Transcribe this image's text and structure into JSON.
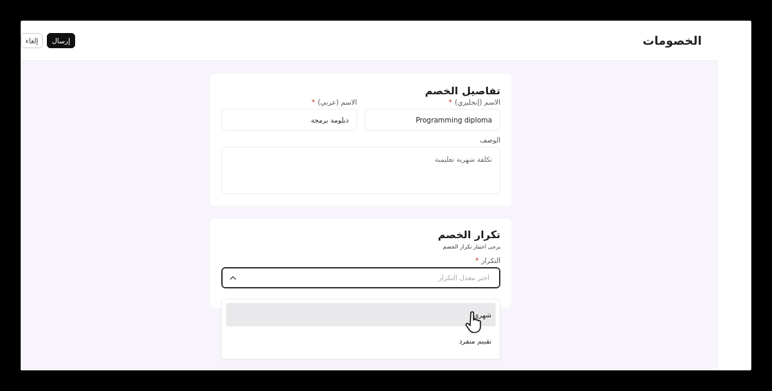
{
  "header": {
    "title": "الخصومات",
    "buttons": [
      {
        "label": "إرسال",
        "kind": "primary"
      },
      {
        "label": "إلغاء",
        "kind": "secondary"
      }
    ]
  },
  "details_card": {
    "title": "تفاصيل الخصم",
    "fields": [
      {
        "label": "الاسم (إنجليزي)",
        "required_mark": "*",
        "value": "Programming diploma"
      },
      {
        "label": "الاسم (عربي)",
        "required_mark": "*",
        "value": "دبلومة برمجة"
      }
    ],
    "description": {
      "label": "الوصف",
      "value": "تكلفة شهرية تعليمية"
    }
  },
  "recurrence_card": {
    "title": "تكرار الخصم",
    "subtitle": "يرجى اختيار تكرار الخصم",
    "field": {
      "label": "التكرار",
      "required_mark": "*",
      "placeholder": "اختر معدل التكرار",
      "expanded": true
    },
    "options": [
      {
        "label": "شهري",
        "hovered": true
      },
      {
        "label": "تقييم منفرد",
        "hovered": false
      }
    ]
  }
}
